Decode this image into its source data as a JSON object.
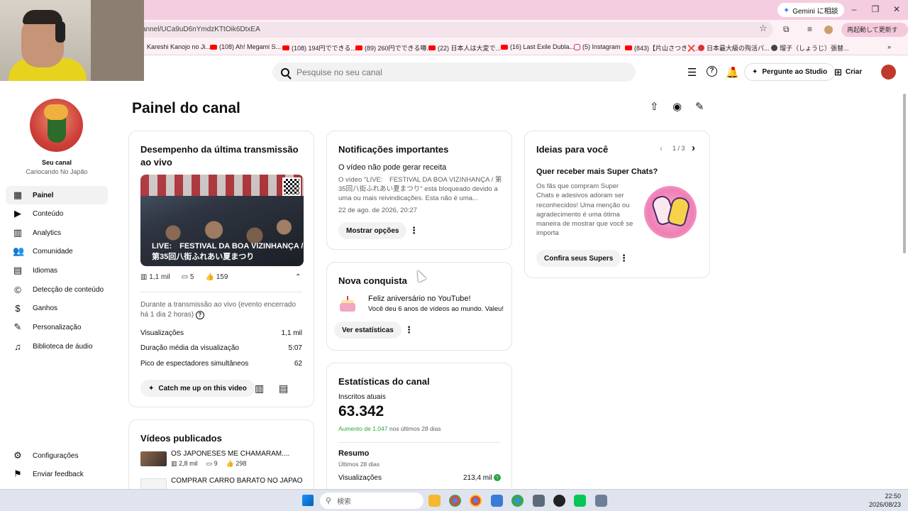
{
  "browser": {
    "gemini_label": "Gemini に相談",
    "url": "annel/UCa9uD6nYmdzKTtOik6DtxEA",
    "restart_label": "再起動して更新する",
    "bookmarks": [
      "Kareshi Kanojo no Ji...",
      "(108) Ah! Megami S...",
      "(108) 194円でできる...",
      "(89) 260円でできる噂...",
      "(22) 日本人は大変で...",
      "(16) Last Exile Dubla...",
      "(5) Instagram",
      "(843)【片山さつき❌...",
      "日本最大級の殉活パ...",
      "瑠子（しょうじ）張替..."
    ]
  },
  "header": {
    "search_placeholder": "Pesquise no seu canal",
    "studio_label": "Pergunte ao Studio",
    "create_label": "Criar"
  },
  "sidebar": {
    "channel_title": "Seu canal",
    "channel_name": "Cariocando No Japão",
    "items": [
      {
        "label": "Painel",
        "icon": "dashboard-icon"
      },
      {
        "label": "Conteúdo",
        "icon": "content-icon"
      },
      {
        "label": "Analytics",
        "icon": "analytics-icon"
      },
      {
        "label": "Comunidade",
        "icon": "community-icon"
      },
      {
        "label": "Idiomas",
        "icon": "subtitles-icon"
      },
      {
        "label": "Detecção de conteúdo",
        "icon": "copyright-icon"
      },
      {
        "label": "Ganhos",
        "icon": "dollar-icon"
      },
      {
        "label": "Personalização",
        "icon": "magic-wand-icon"
      },
      {
        "label": "Biblioteca de áudio",
        "icon": "audio-library-icon"
      }
    ],
    "bottom": [
      {
        "label": "Configurações",
        "icon": "gear-icon"
      },
      {
        "label": "Enviar feedback",
        "icon": "feedback-icon"
      }
    ]
  },
  "page": {
    "title": "Painel do canal"
  },
  "live_card": {
    "title": "Desempenho da última transmissão ao vivo",
    "thumb_caption_1": "LIVE:　FESTIVAL DA BOA VIZINHANÇA /",
    "thumb_caption_2": "第35回八街ふれあい夏まつり",
    "views": "1,1 mil",
    "comments": "5",
    "likes": "159",
    "note": "Durante a transmissão ao vivo (evento encerrado há 1 dia 2 horas)",
    "rows": [
      {
        "label": "Visualizações",
        "value": "1,1 mil"
      },
      {
        "label": "Duração média da visualização",
        "value": "5:07"
      },
      {
        "label": "Pico de espectadores simultâneos",
        "value": "62"
      }
    ],
    "catch_label": "Catch me up on this video"
  },
  "videos_card": {
    "title": "Vídeos publicados",
    "items": [
      {
        "title": "OS JAPONESES ME CHAMARAM....",
        "views": "2,8 mil",
        "comments": "9",
        "likes": "298"
      },
      {
        "title": "COMPRAR CARRO BARATO NO JAPAO",
        "views": "",
        "comments": "",
        "likes": ""
      }
    ]
  },
  "notif_card": {
    "title": "Notificações importantes",
    "heading": "O vídeo não pode gerar receita",
    "body": "O vídeo \"LIVE:　FESTIVAL DA BOA VIZINHANÇA / 第35回八街ふれあい夏まつり\" está bloqueado devido a uma ou mais reivindicações. Esta não é uma...",
    "date": "22 de ago. de 2026, 20:27",
    "button": "Mostrar opções"
  },
  "achievement_card": {
    "title": "Nova conquista",
    "heading": "Feliz aniversário no YouTube!",
    "body": "Você deu 6 anos de vídeos ao mundo. Valeu!",
    "button": "Ver estatísticas"
  },
  "stats_card": {
    "title": "Estatísticas do canal",
    "subs_label": "Inscritos atuais",
    "subs_value": "63.342",
    "growth_highlight": "Aumento de 1.047",
    "growth_rest": "nos últimos 28 dias",
    "summary_title": "Resumo",
    "summary_period": "Últimos 28 dias",
    "views_label": "Visualizações",
    "views_value": "213,4 mil"
  },
  "ideas_card": {
    "title": "Ideias para você",
    "pager": "1 / 3",
    "heading": "Quer receber mais Super Chats?",
    "body": "Os fãs que compram Super Chats e adesivos adoram ser reconhecidos! Uma menção ou agradecimento é uma ótima maneira de mostrar que você se importa",
    "button": "Confira seus Supers"
  },
  "taskbar": {
    "search": "検索",
    "time": "22:50",
    "date": "2026/08/23"
  },
  "colors": {
    "titlebar": "#f5cde0",
    "positive": "#2ba640",
    "accent_red": "#ff0000"
  }
}
